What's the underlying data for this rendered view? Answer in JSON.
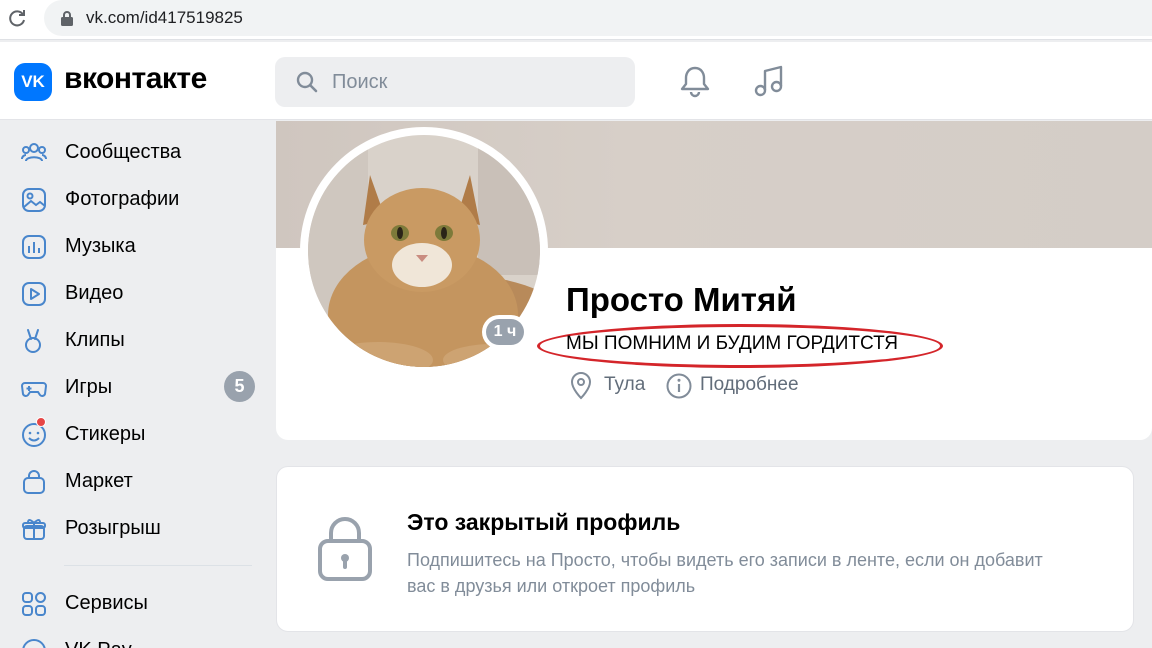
{
  "browser": {
    "url": "vk.com/id417519825"
  },
  "header": {
    "logo_badge": "VK",
    "logo_text": "вконтакте",
    "search_placeholder": "Поиск"
  },
  "sidebar": {
    "items": [
      {
        "label": "Сообщества",
        "icon": "communities-icon"
      },
      {
        "label": "Фотографии",
        "icon": "photos-icon"
      },
      {
        "label": "Музыка",
        "icon": "music-icon"
      },
      {
        "label": "Видео",
        "icon": "video-icon"
      },
      {
        "label": "Клипы",
        "icon": "clips-icon"
      },
      {
        "label": "Игры",
        "icon": "games-icon",
        "badge": "5"
      },
      {
        "label": "Стикеры",
        "icon": "stickers-icon"
      },
      {
        "label": "Маркет",
        "icon": "market-icon"
      },
      {
        "label": "Розыгрыш",
        "icon": "gift-icon"
      },
      {
        "label": "Сервисы",
        "icon": "services-icon"
      },
      {
        "label": "VK Pay",
        "icon": "vkpay-icon"
      }
    ]
  },
  "profile": {
    "name": "Просто Митяй",
    "status": "МЫ ПОМНИМ И БУДИМ ГОРДИТСТЯ",
    "online": "1 ч",
    "city": "Тула",
    "more": "Подробнее"
  },
  "closed": {
    "title": "Это закрытый профиль",
    "description": "Подпишитесь на Просто, чтобы видеть его записи в ленте, если он добавит вас в друзья или откроет профиль"
  },
  "colors": {
    "accent": "#0077ff",
    "highlight": "#d4252a",
    "muted": "#818c99"
  }
}
